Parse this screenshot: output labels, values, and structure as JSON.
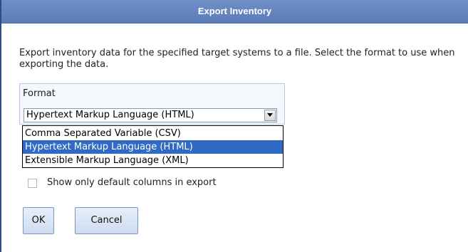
{
  "dialog": {
    "title": "Export Inventory",
    "description": "Export inventory data for the specified target systems to a file. Select the format to use when exporting the data."
  },
  "format": {
    "label": "Format",
    "selected": "Hypertext Markup Language (HTML)",
    "options": [
      "Comma Separated Variable (CSV)",
      "Hypertext Markup Language (HTML)",
      "Extensible Markup Language (XML)"
    ],
    "dropdown_open": true,
    "highlighted_index": 1
  },
  "default_columns": {
    "label": "Show only default columns in export",
    "checked": false
  },
  "buttons": {
    "ok_label": "OK",
    "cancel_label": "Cancel"
  },
  "colors": {
    "title_bar": "#5a7cb8",
    "selection_highlight": "#316ac5",
    "group_background": "#f4f8fc"
  },
  "icons": {
    "dropdown_arrow": "chevron-down-icon"
  }
}
